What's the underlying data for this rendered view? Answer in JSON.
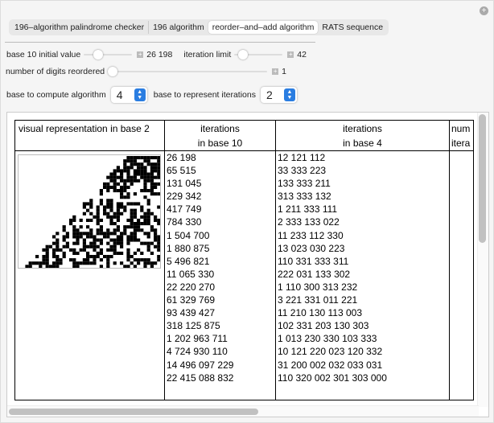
{
  "tabs": [
    {
      "label": "196–algorithm palindrome checker"
    },
    {
      "label": "196 algorithm"
    },
    {
      "label": "reorder–and–add algorithm",
      "active": true
    },
    {
      "label": "RATS sequence"
    }
  ],
  "controls": {
    "initial_value": {
      "label": "base 10 initial value",
      "value": "26 198",
      "fraction": 0.3
    },
    "iteration_limit": {
      "label": "iteration limit",
      "value": "42",
      "fraction": 0.15
    },
    "digits_reordered": {
      "label": "number of digits reordered",
      "value": "1",
      "fraction": 0.0
    },
    "base_compute": {
      "label": "base to compute algorithm",
      "value": "4"
    },
    "base_represent": {
      "label": "base to represent iterations",
      "value": "2"
    }
  },
  "table": {
    "headers": [
      {
        "line1": "visual representation in base 2",
        "line2": ""
      },
      {
        "line1": "iterations",
        "line2": "in base 10"
      },
      {
        "line1": "iterations",
        "line2": "in base 4"
      },
      {
        "line1": "num",
        "line2": "itera"
      }
    ],
    "base10": [
      "26 198",
      "65 515",
      "131 045",
      "229 342",
      "417 749",
      "784 330",
      "1 504 700",
      "1 880 875",
      "5 496 821",
      "11 065 330",
      "22 220 270",
      "61 329 769",
      "93 439 427",
      "318 125 875",
      "1 202 963 711",
      "4 724 930 110",
      "14 496 097 229",
      "22 415 088 832"
    ],
    "base4": [
      "12 121 112",
      "33 333 223",
      "133 333 211",
      "313 333 132",
      "1 211 333 111",
      "2 333 133 022",
      "11 233 112 330",
      "13 023 030 223",
      "110 331 333 311",
      "222 031 133 302",
      "1 110 300 313 232",
      "3 221 331 011 221",
      "11 210 130 113 003",
      "102 331 203 130 303",
      "1 013 230 330 103 333",
      "10 121 220 023 120 332",
      "31 200 002 032 033 031",
      "110 320 002 301 303 000"
    ]
  }
}
